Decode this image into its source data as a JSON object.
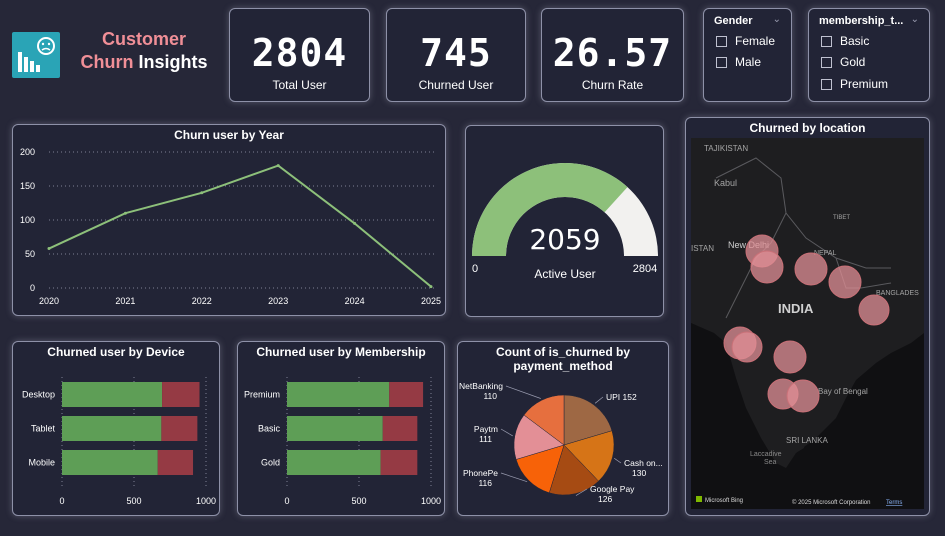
{
  "header": {
    "title_word1": "Customer",
    "title_word2": "Churn",
    "title_word3": "Insights"
  },
  "kpis": [
    {
      "value": "2804",
      "label": "Total User"
    },
    {
      "value": "745",
      "label": "Churned User"
    },
    {
      "value": "26.57",
      "label": "Churn Rate"
    }
  ],
  "slicers": {
    "gender": {
      "title": "Gender",
      "options": [
        "Female",
        "Male"
      ]
    },
    "membership": {
      "title": "membership_t...",
      "options": [
        "Basic",
        "Gold",
        "Premium"
      ]
    }
  },
  "gauge": {
    "value": "2059",
    "label": "Active User",
    "min": "0",
    "max": "2804"
  },
  "map": {
    "title": "Churned by location",
    "labels": {
      "tajikistan": "TAJIKISTAN",
      "kabul": "Kabul",
      "tibet": "TIBET",
      "new_delhi": "New Delhi",
      "nepal": "NEPAL",
      "india": "INDIA",
      "istan": "ISTAN",
      "bangladesh": "BANGLADES",
      "bay": "Bay of Bengal",
      "sri_lanka": "SRI LANKA",
      "laccadive": "Laccadive\nSea",
      "bing": "Microsoft Bing",
      "copyright": "© 2025 Microsoft Corporation",
      "terms": "Terms"
    }
  },
  "colors": {
    "accent_green": "#8dc07a",
    "bar_green": "#5e9e56",
    "bar_red": "#953a44",
    "title_pink": "#f08f97"
  },
  "chart_data": [
    {
      "type": "line",
      "title": "Churn user by Year",
      "x": [
        "2020",
        "2021",
        "2022",
        "2023",
        "2024",
        "2025"
      ],
      "series": [
        {
          "values": [
            58,
            110,
            140,
            180,
            95,
            2
          ]
        }
      ],
      "ylim": [
        0,
        200
      ],
      "yticks": [
        0,
        50,
        100,
        150,
        200
      ],
      "color": "#8dc07a"
    },
    {
      "type": "bar",
      "title": "Churned user by Device",
      "orientation": "horizontal",
      "stacked": true,
      "categories": [
        "Desktop",
        "Tablet",
        "Mobile"
      ],
      "series": [
        {
          "values": [
            695,
            690,
            665
          ],
          "color": "#5e9e56"
        },
        {
          "values": [
            260,
            250,
            245
          ],
          "color": "#953a44"
        }
      ],
      "xlim": [
        0,
        1000
      ],
      "xticks": [
        0,
        500,
        1000
      ]
    },
    {
      "type": "bar",
      "title": "Churned user by Membership",
      "orientation": "horizontal",
      "stacked": true,
      "categories": [
        "Premium",
        "Basic",
        "Gold"
      ],
      "series": [
        {
          "values": [
            710,
            665,
            650
          ],
          "color": "#5e9e56"
        },
        {
          "values": [
            235,
            240,
            255
          ],
          "color": "#953a44"
        }
      ],
      "xlim": [
        0,
        1000
      ],
      "xticks": [
        0,
        500,
        1000
      ]
    },
    {
      "type": "pie",
      "title": "Count of is_churned by payment_method",
      "slices": [
        {
          "label": "UPI",
          "value": 152,
          "color": "#9e6844"
        },
        {
          "label": "Cash on...",
          "value": 130,
          "color": "#d67417"
        },
        {
          "label": "Google Pay",
          "value": 126,
          "color": "#a64b13"
        },
        {
          "label": "PhonePe",
          "value": 116,
          "color": "#f76208"
        },
        {
          "label": "Paytm",
          "value": 111,
          "color": "#e38f96"
        },
        {
          "label": "NetBanking",
          "value": 110,
          "color": "#e66f3e"
        }
      ]
    }
  ]
}
